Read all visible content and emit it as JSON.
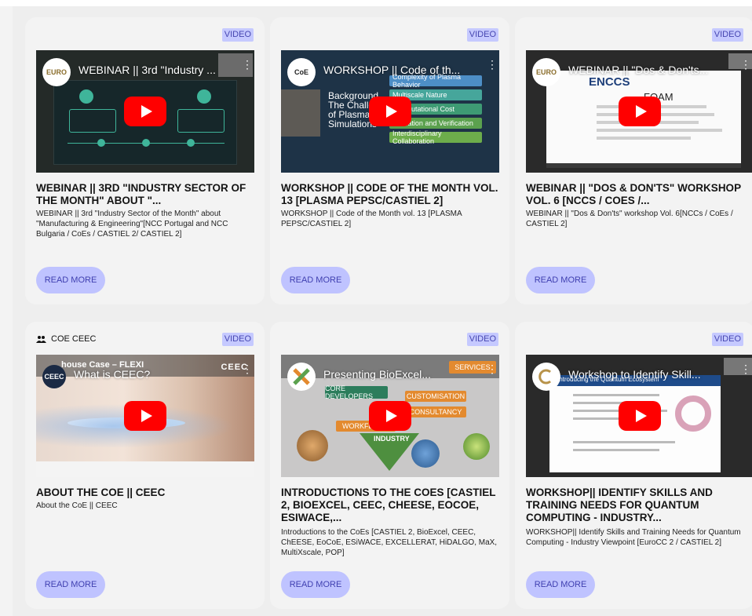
{
  "badge_label": "VIDEO",
  "read_more_label": "READ MORE",
  "cards": [
    {
      "video_title": "WEBINAR || 3rd \"Industry ...",
      "avatar_text": "EURO",
      "title": "WEBINAR || 3RD \"INDUSTRY SECTOR OF THE MONTH\" ABOUT \"...",
      "description": "WEBINAR || 3rd \"Industry Sector of the Month\" about \"Manufacturing & Engineering\"[NCC Portugal and NCC Bulgaria / CoEs / CASTIEL 2/ CASTIEL 2]"
    },
    {
      "video_title": "WORKSHOP || Code of th...",
      "avatar_text": "CoE",
      "title": "WORKSHOP || CODE OF THE MONTH VOL. 13 [PLASMA PEPSC/CASTIEL 2]",
      "description": "WORKSHOP || Code of the Month vol. 13 [PLASMA PEPSC/CASTIEL 2]",
      "slide_items": [
        "Complexity of Plasma Behavior",
        "Multiscale Nature",
        "Computational Cost",
        "Validation and Verification",
        "Interdisciplinary Collaboration"
      ],
      "slide_left": "Background The Challe of Plasma Simulations"
    },
    {
      "video_title": "WEBINAR || \"Dos & Don'ts...",
      "avatar_text": "EURO",
      "title": "WEBINAR || \"DOS & DON'TS\" WORKSHOP VOL. 6 [NCCS / COES /...",
      "description": "WEBINAR || \"Dos & Don'ts\" workshop Vol. 6[NCCs / CoEs / CASTIEL 2]",
      "slide_heading": "ENCCS",
      "slide_sub": "FOAM"
    },
    {
      "coe_label": "COE CEEC",
      "video_title": "What is CEEC?",
      "avatar_text": "CEEC",
      "slide_top": "house Case – FLEXI",
      "slide_brand": "CEEC",
      "title": "ABOUT THE COE || CEEC",
      "description": "About the CoE || CEEC"
    },
    {
      "video_title": "Presenting BioExcel...",
      "slide_tags": [
        "CORE DEVELOPERS",
        "CUSTOMISATION",
        "WORKFLOWS",
        "CONSULTANCY",
        "INDUSTRY",
        "SERVICES"
      ],
      "title": "INTRODUCTIONS TO THE COES [CASTIEL 2, BIOEXCEL, CEEC, CHEESE, EOCOE, ESIWACE,...",
      "description": "Introductions to the CoEs [CASTIEL 2, BioExcel, CEEC, ChEESE, EoCoE, ESiWACE, EXCELLERAT, HiDALGO, MaX, MultiXscale, POP]"
    },
    {
      "video_title": "Workshop to Identify Skill...",
      "avatar_text": "EURO",
      "slide_heading": "Introducing the Quantum Ecosystem",
      "title": "WORKSHOP|| IDENTIFY SKILLS AND TRAINING NEEDS FOR QUANTUM COMPUTING - INDUSTRY...",
      "description": "WORKSHOP|| Identify Skills and Training Needs for Quantum Computing - Industry Viewpoint [EuroCC 2 / CASTIEL 2]"
    }
  ]
}
